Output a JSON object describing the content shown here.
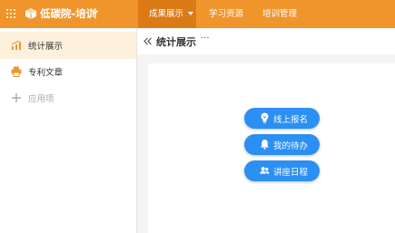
{
  "header": {
    "app_title": "低碳院-培训",
    "nav": [
      {
        "label": "成果展示",
        "active": true
      },
      {
        "label": "学习资源",
        "active": false
      },
      {
        "label": "培训管理",
        "active": false
      }
    ],
    "colors": {
      "bar": "#f0952b",
      "active": "#dc7a16"
    }
  },
  "sidebar": {
    "items": [
      {
        "label": "统计展示",
        "icon": "chart-icon",
        "active": true
      },
      {
        "label": "专利文章",
        "icon": "printer-icon",
        "active": false
      },
      {
        "label": "应用项",
        "icon": "plus-icon",
        "active": false
      }
    ]
  },
  "main": {
    "title": "统计展示",
    "more": "···",
    "buttons": [
      {
        "label": "线上报名",
        "icon": "lightbulb-icon"
      },
      {
        "label": "我的待办",
        "icon": "bell-icon"
      },
      {
        "label": "讲座日程",
        "icon": "users-icon"
      }
    ],
    "accent": "#2b8ff3"
  }
}
